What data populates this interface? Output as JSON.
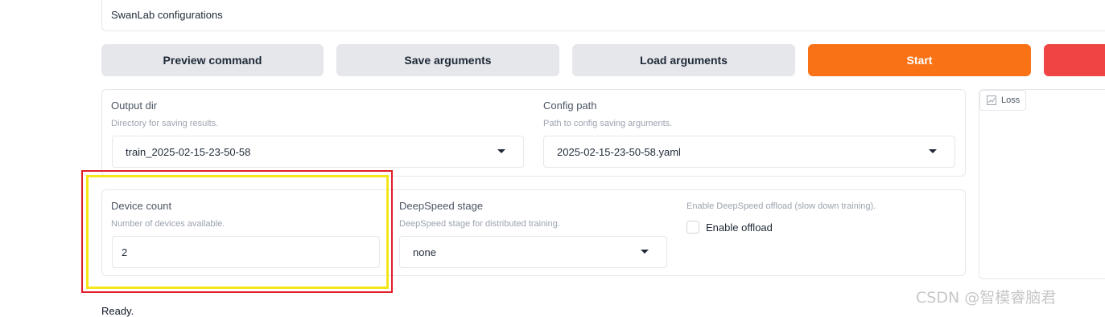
{
  "accordion": {
    "title": "SwanLab configurations"
  },
  "actions": {
    "preview_label": "Preview command",
    "save_label": "Save arguments",
    "load_label": "Load arguments",
    "start_label": "Start",
    "primary_color": "#f97316",
    "stop_color": "#ef4444"
  },
  "output": {
    "output_dir": {
      "label": "Output dir",
      "info": "Directory for saving results.",
      "value": "train_2025-02-15-23-50-58"
    },
    "config_path": {
      "label": "Config path",
      "info": "Path to config saving arguments.",
      "value": "2025-02-15-23-50-58.yaml"
    }
  },
  "device": {
    "device_count": {
      "label": "Device count",
      "info": "Number of devices available.",
      "value": "2"
    },
    "ds_stage": {
      "label": "DeepSpeed stage",
      "info": "DeepSpeed stage for distributed training.",
      "value": "none"
    },
    "ds_offload": {
      "info": "Enable DeepSpeed offload (slow down training).",
      "checkbox_label": "Enable offload",
      "checked": false
    }
  },
  "plot": {
    "tab_label": "Loss",
    "icon": "chart-icon"
  },
  "status": {
    "text": "Ready."
  },
  "watermark": {
    "text": "CSDN @智模睿脑君"
  },
  "highlight": {
    "outer_color": "#e11d2a",
    "inner_color": "#f5e61a"
  }
}
